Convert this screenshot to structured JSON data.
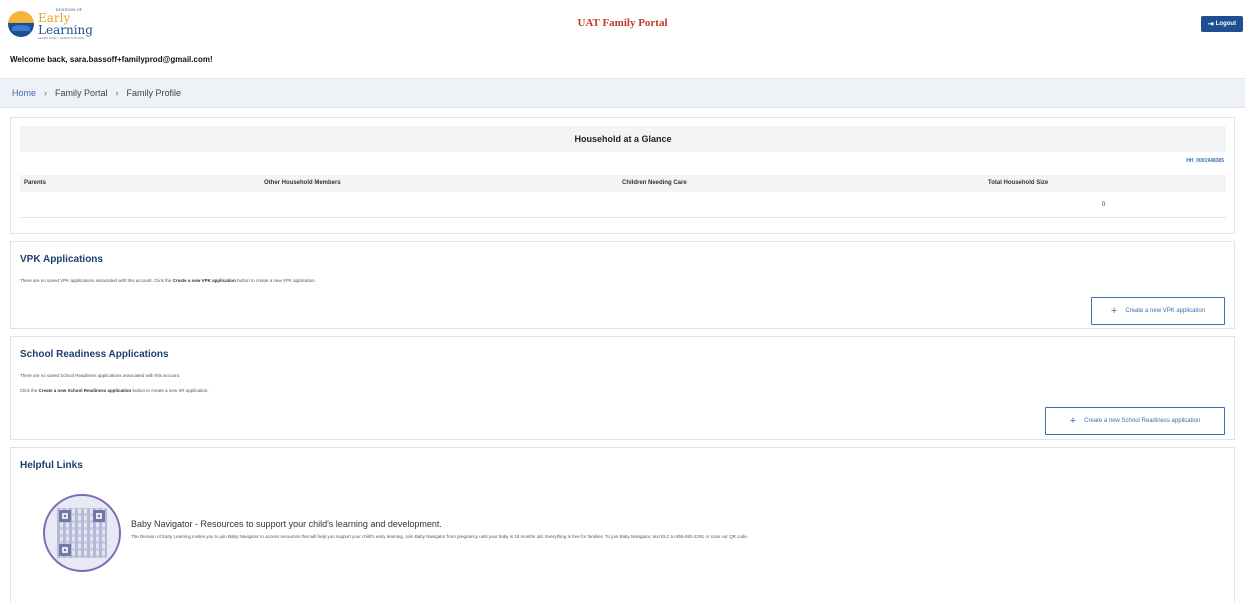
{
  "header": {
    "logo": {
      "small": "DIVISION OF",
      "main_a": "Early",
      "main_b": "Learning",
      "tagline": "LEARN EARLY, LEARN FOR LIFE"
    },
    "title": "UAT Family Portal",
    "logout_label": "Logout"
  },
  "welcome": "Welcome back, sara.bassoff+familyprod@gmail.com!",
  "breadcrumb": [
    {
      "label": "Home"
    },
    {
      "label": "Family Portal"
    },
    {
      "label": "Family Profile"
    }
  ],
  "breadcrumb_sep": "›",
  "household": {
    "title": "Household at a Glance",
    "id": "HH_0001948385",
    "columns": [
      "Parents",
      "Other Household Members",
      "Children Needing Care",
      "Total Household Size"
    ],
    "values": [
      "",
      "",
      "",
      "0"
    ]
  },
  "vpk": {
    "title": "VPK Applications",
    "note_pre": "There are no saved VPK applications associated with this account. Click the ",
    "note_bold": "Create a new VPK application",
    "note_post": " button to create a new VPK application.",
    "button": "Create a new VPK application"
  },
  "sr": {
    "title": "School Readiness Applications",
    "note1": "There are no saved School Readiness applications associated with this account.",
    "note2_pre": "Click the ",
    "note2_bold": "Create a new School Readiness application",
    "note2_post": " button to create a new SR application.",
    "button": "Create a new School Readiness application"
  },
  "links": {
    "title": "Helpful Links",
    "items": [
      {
        "title": "Baby Navigator - Resources to support your child's learning and development.",
        "description": "The Division of Early Learning invites you to join Baby Navigator to access resources that will help you support your child's early learning. Join Baby Navigator from pregnancy until your baby is 18 months old. Everything is free for families. To join Baby Navigator, text ELC to 855-692-2291 or scan our QR code."
      }
    ]
  },
  "colors": {
    "brand": "#1d4f91",
    "title_red": "#c0392b",
    "link": "#3a6fb0"
  }
}
